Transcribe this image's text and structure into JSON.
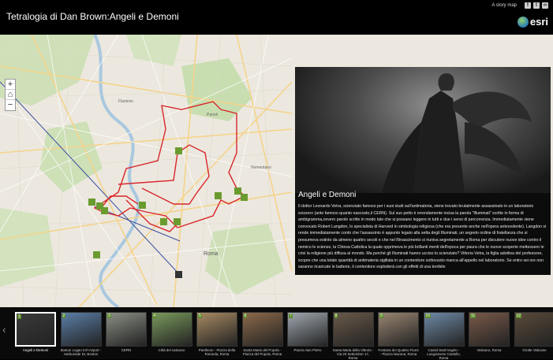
{
  "header": {
    "title": "Tetralogia di Dan Brown:Angeli e Demoni",
    "story_map_label": "A story map",
    "share_icons": [
      "facebook-icon",
      "twitter-icon",
      "link-icon"
    ],
    "logo_text": "esri"
  },
  "map": {
    "zoom_in": "+",
    "home": "⌂",
    "zoom_out": "−",
    "labels": {
      "roma": "Roma",
      "nomentano": "Nomentano",
      "flaminio": "Flaminio",
      "parioli": "Parioli"
    },
    "route_color": "#d9262b"
  },
  "panel": {
    "title": "Angeli e Demoni",
    "text": "Il dottor Leonardo Vetra, scienziato famoso per i suoi studi sull'antimateria, viene trovato brutalmente assassinato in un laboratorio svizzero (anto famoso quanto nascosto,il CERN). Sul suo petto è orrendamente incisa la parola \"Illuminati\" scritte in forma di ambigramma,ovvero parole scritte in modo tale che si possano leggere in tutti e due i sensi di percorrenza. Immediatamente viene convocato Robert Langdon, lo specialista di Harvard in simbologia religiosa (che era presente anche nell'opera antecedente). Langdon si rende immediatamente conto che l'assassinio è appunto legato alla setta degli Illuminati, un segreto ordine di fratellanza che si presumeva estinto da almeno quattro secoli e che nel Rinascimento si riuniva segretamente a Roma per discutere nuove idee contro il nemico le scienze, la Chiesa Cattolica la quale opprimeva le più brillanti menti dell'epoca per paura che le nuove scoperte mettessero in crisi la religione più diffusa al mondo. Ma perché gli Illuminati hanno ucciso lo scienziato? Vittoria Vetra, la figlia adottiva del professore, scopre che una letale quantità di antimateria sigillata in un contenitore sottovuoto manca all'appello nel laboratorio. Se entro sei ore non saranno ricaricate le batterie, il contenitore esploderà con gli effetti di una terribile"
  },
  "thumbnails": [
    {
      "num": "1",
      "caption": "Angeli e Demoni",
      "color": "#3a3a3a"
    },
    {
      "num": "2",
      "caption": "Boston Logan Int'l Airport - Harborside Dr, Boston",
      "color": "#5b7fa8"
    },
    {
      "num": "3",
      "caption": "CERN",
      "color": "#8a8f84"
    },
    {
      "num": "4",
      "caption": "Città del vaticano",
      "color": "#7a9a5c"
    },
    {
      "num": "5",
      "caption": "Pantheon - Piazza della Rotonda, Roma",
      "color": "#a78a62"
    },
    {
      "num": "6",
      "caption": "Santa Maria del Popolo - Piazza del Popolo, Roma",
      "color": "#8c6a4a"
    },
    {
      "num": "7",
      "caption": "Piazza San Pietro",
      "color": "#a0a8b0"
    },
    {
      "num": "8",
      "caption": "Santa Maria della Vittoria - Via 20 Settembre 17, Roma",
      "color": "#6a5a4a"
    },
    {
      "num": "9",
      "caption": "Fontana dei Quattro Fiumi - Piazza Navona, Roma",
      "color": "#9a8672"
    },
    {
      "num": "10",
      "caption": "Castel Sant'Angelo - Lungotevere Castello, Roma",
      "color": "#6f8aa6"
    },
    {
      "num": "11",
      "caption": "Vaticano, Roma",
      "color": "#7a5a4a"
    },
    {
      "num": "12",
      "caption": "Grotte Vaticane",
      "color": "#5a4a3a"
    }
  ],
  "strip": {
    "prev": "‹",
    "next": "›"
  }
}
